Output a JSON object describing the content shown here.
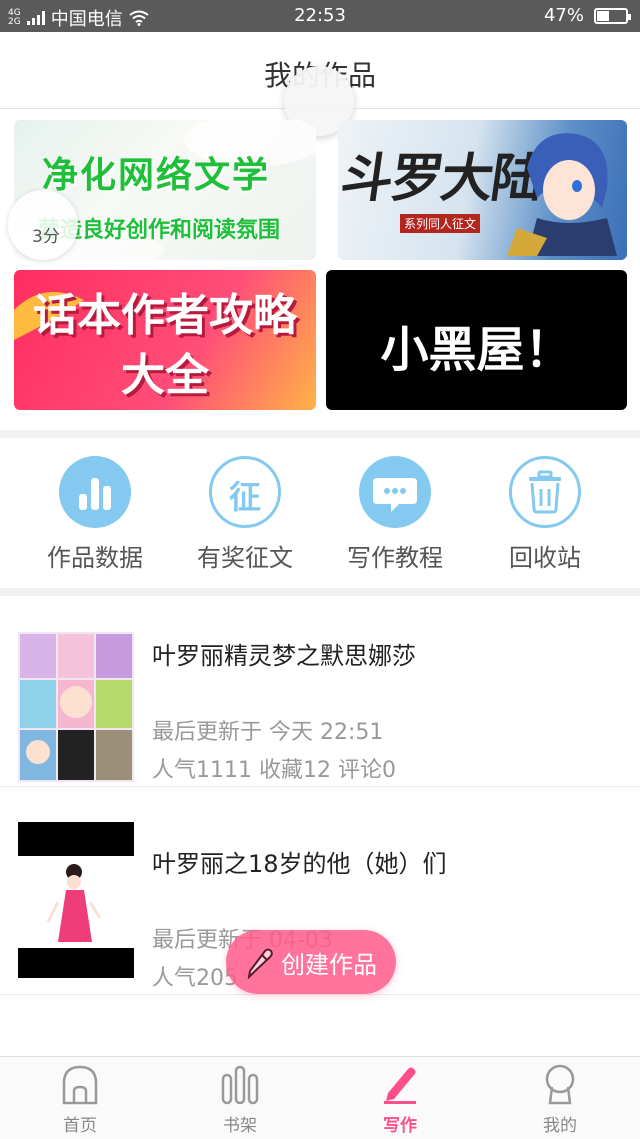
{
  "status_bar": {
    "network": "4G|2G",
    "carrier": "中国电信",
    "time": "22:53",
    "battery": "47%",
    "battery_level": 0.47
  },
  "header": {
    "title": "我的作品"
  },
  "banners": {
    "b1": {
      "line1": "净化网络文学",
      "line2": "营造良好创作和阅读氛围"
    },
    "b2": {
      "title": "斗罗大陆",
      "subtitle": "系列同人征文"
    },
    "b3": {
      "line1": "话本作者攻略",
      "line2": "大全"
    },
    "b4": {
      "title": "小黑屋！"
    },
    "timer": "3分"
  },
  "quick_menu": [
    {
      "label": "作品数据",
      "icon": "bar-chart-icon"
    },
    {
      "label": "有奖征文",
      "icon": "zheng-badge-icon",
      "glyph": "征"
    },
    {
      "label": "写作教程",
      "icon": "chat-bubble-icon"
    },
    {
      "label": "回收站",
      "icon": "trash-icon"
    }
  ],
  "works": [
    {
      "title": "叶罗丽精灵梦之默思娜莎",
      "updated": "最后更新于 今天 22:51",
      "stats": "人气1111 收藏12 评论0"
    },
    {
      "title": "叶罗丽之18岁的他（她）们",
      "updated": "最后更新于 04-03",
      "stats": "人气205"
    }
  ],
  "create_button": {
    "label": "创建作品"
  },
  "tabbar": [
    {
      "label": "首页",
      "active": false
    },
    {
      "label": "书架",
      "active": false
    },
    {
      "label": "写作",
      "active": true
    },
    {
      "label": "我的",
      "active": false
    }
  ],
  "colors": {
    "accent": "#ff4f8b",
    "icon_blue": "#84c9f0",
    "status_bar": "#5a5a5a"
  }
}
